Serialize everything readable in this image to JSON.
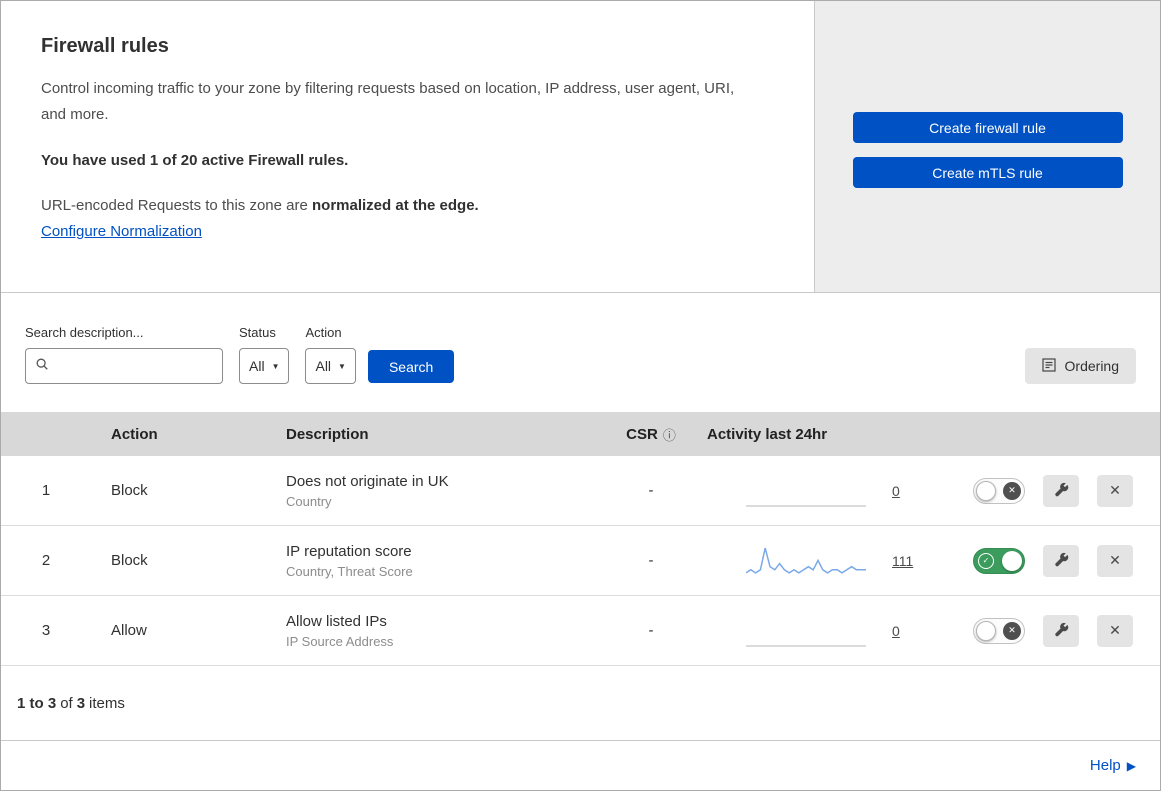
{
  "colors": {
    "primary_blue": "#0051c3",
    "link_blue": "#0051c3",
    "toggle_on_green": "#3b9c5d",
    "sparkline_blue": "#7aa9e8",
    "sparkline_flat_gray": "#cfcfcf"
  },
  "icons": {
    "dropdown_arrow": "▼",
    "info": "ⓘ",
    "close": "✕",
    "check": "✓",
    "help_arrow": "▶"
  },
  "header": {
    "title": "Firewall rules",
    "description": "Control incoming traffic to your zone by filtering requests based on location, IP address, user agent, URI, and more.",
    "usage": "You have used 1 of 20 active Firewall rules.",
    "norm_prefix": "URL-encoded Requests to this zone are ",
    "norm_bold": "normalized at the edge.",
    "configure_link": "Configure Normalization",
    "create_firewall_label": "Create firewall rule",
    "create_mtls_label": "Create mTLS rule"
  },
  "filters": {
    "search_label": "Search description...",
    "search_value": "",
    "status_label": "Status",
    "status_value": "All",
    "action_label": "Action",
    "action_value": "All",
    "search_button": "Search",
    "ordering_button": "Ordering"
  },
  "table": {
    "headers": {
      "action": "Action",
      "description": "Description",
      "csr": "CSR",
      "activity": "Activity last 24hr"
    },
    "rows": [
      {
        "index": "1",
        "action": "Block",
        "description": "Does not originate in UK",
        "subtext": "Country",
        "csr": "-",
        "activity_count": "0",
        "enabled": false,
        "sparkline": {
          "points": [
            0,
            0,
            0,
            0,
            0,
            0,
            0,
            0,
            0,
            0,
            0,
            0
          ],
          "color": "#cfcfcf"
        }
      },
      {
        "index": "2",
        "action": "Block",
        "description": "IP reputation score",
        "subtext": "Country, Threat Score",
        "csr": "-",
        "activity_count": "111",
        "enabled": true,
        "sparkline": {
          "points": [
            1,
            2,
            1,
            2,
            9,
            3,
            2,
            4,
            2,
            1,
            2,
            1,
            2,
            3,
            2,
            5,
            2,
            1,
            2,
            2,
            1,
            2,
            3,
            2,
            2,
            2
          ],
          "color": "#7aa9e8"
        }
      },
      {
        "index": "3",
        "action": "Allow",
        "description": "Allow listed IPs",
        "subtext": "IP Source Address",
        "csr": "-",
        "activity_count": "0",
        "enabled": false,
        "sparkline": {
          "points": [
            0,
            0,
            0,
            0,
            0,
            0,
            0,
            0,
            0,
            0,
            0,
            0
          ],
          "color": "#cfcfcf"
        }
      }
    ]
  },
  "footer": {
    "range": "1 to 3",
    "of_text": "of",
    "total": "3",
    "items_text": "items",
    "help": "Help"
  }
}
